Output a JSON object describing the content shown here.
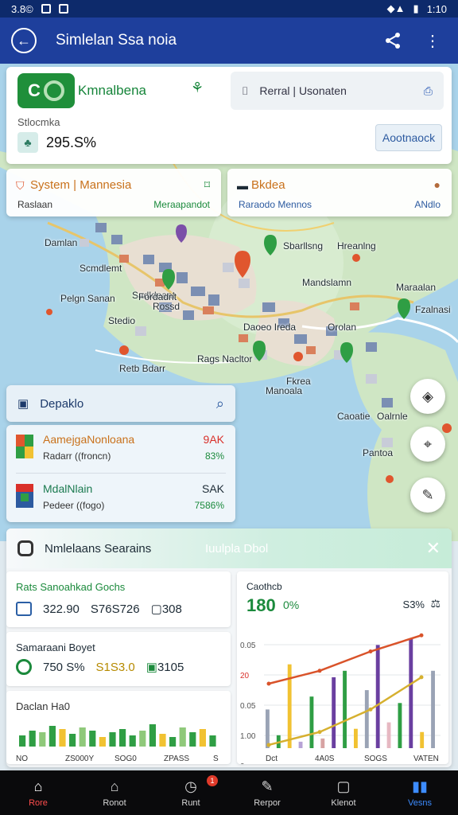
{
  "status_bar": {
    "left_text": "3.8©",
    "time": "1:10"
  },
  "app_bar": {
    "title": "Simlelan Ssa noia"
  },
  "top_card": {
    "brand": "Kmnalbena",
    "search_text": "Rerral | Usonaten",
    "stat_label": "Stlocmka",
    "stat_value": "295.S%",
    "action_label": "Aootnaock"
  },
  "info_cards": [
    {
      "title": "System | Mannesia",
      "sub_left": "Raslaan",
      "sub_right": "Meraapandot"
    },
    {
      "title": "Bkdea",
      "sub_left": "Raraodo Mennos",
      "sub_right": "ANdlo"
    }
  ],
  "map": {
    "labels": [
      "Damlan",
      "Scmdlemt",
      "Sbarllsng",
      "Hreanlng",
      "Sadldeaat",
      "Fordadnt",
      "Pelgn Sanan",
      "Rossd",
      "Mandslamn",
      "Maraalan",
      "Fzalnasi",
      "Stedio",
      "Daoeo Ireda",
      "Orolan",
      "Retb Bdarr",
      "Fkrea",
      "Rags Nacltor",
      "Manoala",
      "Caoatie",
      "Oalrnle",
      "Pantoa"
    ]
  },
  "search_card": {
    "label": "Depaklo"
  },
  "stocks": [
    {
      "name": "AamejgaNonloana",
      "sub": "Radarr ((froncn)",
      "value": "9AK",
      "change": "83%"
    },
    {
      "name": "MdalNlain",
      "sub": "Pedeer ((fogo)",
      "value": "SAK",
      "change": "7586%"
    }
  ],
  "panel": {
    "title": "Nmlelaans Searains",
    "center_text": "Iuulpla Dbol",
    "mini_cards": [
      {
        "title": "Rats Sanoahkad Gochs",
        "values": [
          "322.90",
          "S76S726",
          "308"
        ]
      },
      {
        "title": "Samaraani Boyet",
        "values": [
          "750 S%",
          "S1S3.0",
          "3105"
        ]
      },
      {
        "title": "Daclan Ha0",
        "x_ticks": [
          "NO",
          "ZS000Y",
          "SOG0",
          "ZPASS",
          "S"
        ]
      }
    ],
    "chart": {
      "title": "Caothcb",
      "big_value": "180",
      "pct": "0%",
      "right_value": "S3%",
      "y_ticks": [
        "0.05",
        "20",
        "0.05",
        "1.00",
        "0"
      ],
      "x_ticks": [
        "Dct",
        "4A0S",
        "SOGS",
        "VATEN"
      ]
    }
  },
  "nav": [
    {
      "label": "Rore",
      "icon": "home-icon"
    },
    {
      "label": "Ronot",
      "icon": "building-icon"
    },
    {
      "label": "Runt",
      "icon": "clock-icon",
      "badge": "1"
    },
    {
      "label": "Rerpor",
      "icon": "edit-icon"
    },
    {
      "label": "Klenot",
      "icon": "square-icon"
    },
    {
      "label": "Vesns",
      "icon": "bars-icon"
    }
  ],
  "chart_data": [
    {
      "type": "bar",
      "title": "Daclan Ha0",
      "categories": [
        "NO",
        "ZS000Y",
        "SOG0",
        "ZPASS",
        "S"
      ],
      "series": [
        {
          "values": [
            14,
            20,
            18,
            26,
            22,
            16,
            24,
            20,
            12,
            18,
            22,
            14,
            20,
            28,
            16,
            12,
            24,
            18,
            22,
            14
          ]
        }
      ]
    },
    {
      "type": "line",
      "title": "Caothcb",
      "x": [
        "Dct",
        "4A0S",
        "SOGS",
        "VATEN"
      ],
      "series": [
        {
          "values": [
            100,
            120,
            150,
            175
          ]
        },
        {
          "values": [
            5,
            25,
            60,
            110
          ]
        },
        {
          "bars": [
            60,
            20,
            130,
            10,
            80,
            15,
            110,
            120,
            30,
            90,
            160,
            40,
            70,
            170,
            25,
            120
          ]
        }
      ]
    }
  ]
}
